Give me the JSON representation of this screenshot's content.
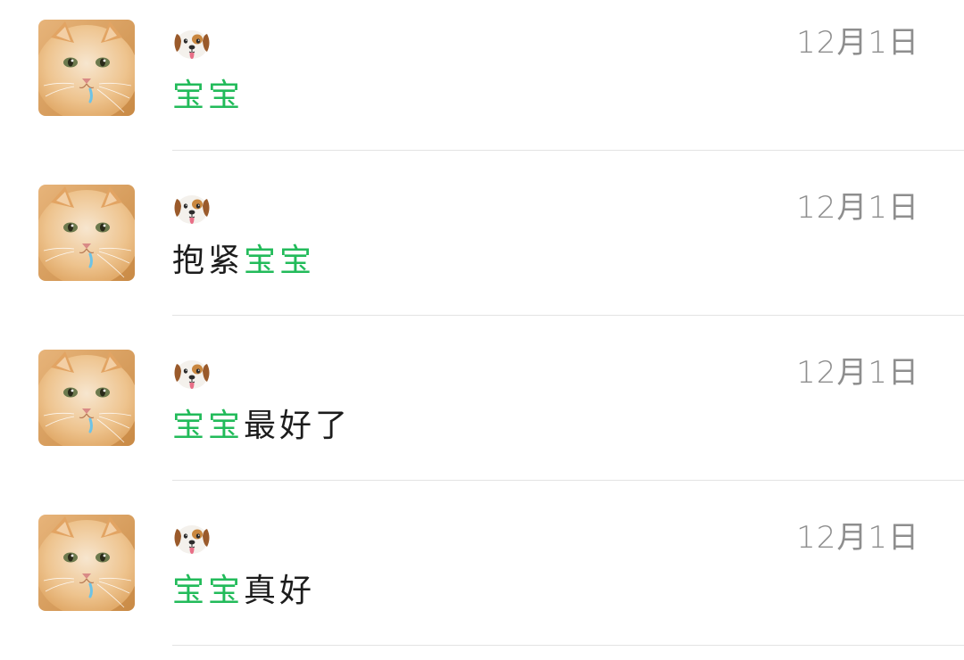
{
  "colors": {
    "highlight": "#22bb5a",
    "text": "#1c1c1c",
    "date": "#8e8e8e",
    "divider": "#e4e4e4"
  },
  "conversations": [
    {
      "avatar_icon": "orange-cat-avatar",
      "name_icon": "dog-face-emoji",
      "date": "12月1日",
      "message": {
        "before": "",
        "highlight": "宝宝",
        "after": ""
      }
    },
    {
      "avatar_icon": "orange-cat-avatar",
      "name_icon": "dog-face-emoji",
      "date": "12月1日",
      "message": {
        "before": "抱紧",
        "highlight": "宝宝",
        "after": ""
      }
    },
    {
      "avatar_icon": "orange-cat-avatar",
      "name_icon": "dog-face-emoji",
      "date": "12月1日",
      "message": {
        "before": "",
        "highlight": "宝宝",
        "after": "最好了"
      }
    },
    {
      "avatar_icon": "orange-cat-avatar",
      "name_icon": "dog-face-emoji",
      "date": "12月1日",
      "message": {
        "before": "",
        "highlight": "宝宝",
        "after": "真好"
      }
    }
  ]
}
